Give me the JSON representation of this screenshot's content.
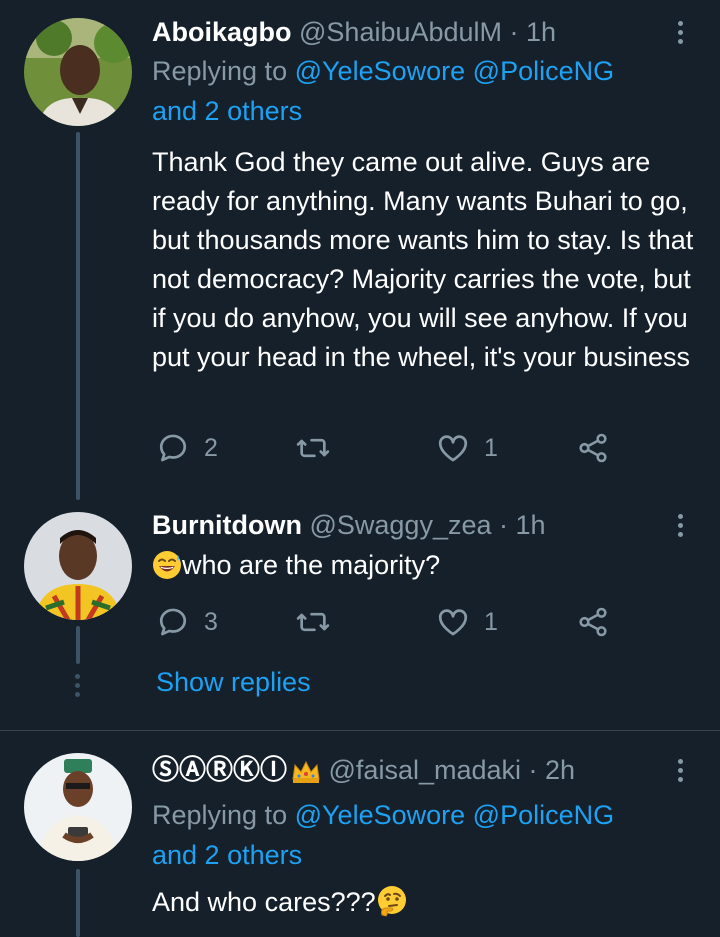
{
  "tweets": [
    {
      "name": "Aboikagbo",
      "handle": "@ShaibuAbdulM · 1h",
      "replying_prefix": "Replying to",
      "mention1": "@YeleSowore",
      "mention2": "@PoliceNG",
      "and_others": "and 2 others",
      "text": "Thank God they came out alive. Guys are ready for anything. Many wants Buhari to go, but thousands more wants him to stay. Is that not democracy? Majority carries the vote, but if you do anyhow, you will see anyhow. If you put your head in the wheel, it's your business",
      "replies": "2",
      "retweets": "",
      "likes": "1"
    },
    {
      "name": "Burnitdown",
      "handle": "@Swaggy_zea · 1h",
      "text": "who are the majority?",
      "replies": "3",
      "retweets": "",
      "likes": "1"
    },
    {
      "name": "ⓈⒶⓇⓀⒾ",
      "handle": "@faisal_madaki · 2h",
      "replying_prefix": "Replying to",
      "mention1": "@YeleSowore",
      "mention2": "@PoliceNG",
      "and_others": "and 2 others",
      "text": "And who cares???"
    }
  ],
  "show_replies": "Show replies",
  "icons": {
    "reply": "reply-icon",
    "retweet": "retweet-icon",
    "like": "heart-icon",
    "share": "share-icon",
    "more": "more-vertical-icon"
  },
  "colors": {
    "background": "#15202b",
    "link": "#1da1f2",
    "secondary": "#8899a6"
  }
}
